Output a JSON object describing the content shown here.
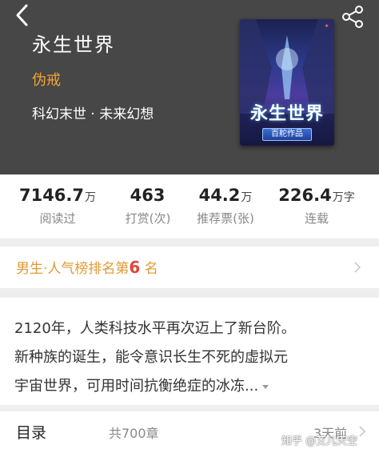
{
  "header": {
    "title": "永生世界",
    "author": "伪戒",
    "category": "科幻末世 · 未来幻想",
    "bg_color": "#474747",
    "author_color": "#f3a530"
  },
  "cover": {
    "title_text": "永生世界",
    "badge_text": "百舵作品"
  },
  "stats": [
    {
      "value": "7146.7",
      "unit": "万",
      "label": "阅读过"
    },
    {
      "value": "463",
      "unit": "",
      "label": "打赏(次)"
    },
    {
      "value": "44.2",
      "unit": "万",
      "label": "推荐票(张)"
    },
    {
      "value": "226.4",
      "unit": "万字",
      "label": "连载"
    }
  ],
  "rank": {
    "prefix": "男生·人气榜排名第",
    "number": "6",
    "suffix": "名",
    "number_color": "#e0453b"
  },
  "intro": {
    "line1": "2120年，人类科技水平再次迈上了新台阶。",
    "line2": "新种族的诞生，能令意识长生不死的虚拟元",
    "line3": "宇宙世界，可用时间抗衡绝症的冰冻..."
  },
  "toc": {
    "label": "目录",
    "count": "共700章",
    "updated": "3天前"
  },
  "watermark": "知乎 @艾儿天空",
  "icons": [
    "back-arrow-icon",
    "share-icon",
    "chevron-right-icon",
    "chevron-down-icon"
  ]
}
